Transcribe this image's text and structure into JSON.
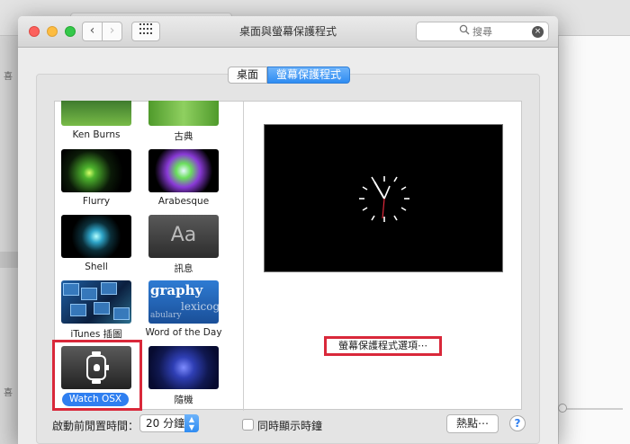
{
  "window": {
    "title": "桌面與螢幕保護程式"
  },
  "toolbar": {
    "back_label": "‹",
    "forward_label": "›",
    "grid_label": "▪▪▪▪"
  },
  "search": {
    "placeholder": "搜尋",
    "clear_label": "×"
  },
  "tabs": [
    {
      "label": "桌面",
      "selected": false
    },
    {
      "label": "螢幕保護程式",
      "selected": true
    }
  ],
  "screensavers": [
    {
      "name": "Ken Burns"
    },
    {
      "name": "古典"
    },
    {
      "name": "Flurry"
    },
    {
      "name": "Arabesque"
    },
    {
      "name": "Shell"
    },
    {
      "name": "訊息",
      "preview_text": "Aa"
    },
    {
      "name": "iTunes 插圖"
    },
    {
      "name": "Word of the Day",
      "preview_words": [
        "graphy",
        "lexicog",
        "abulary"
      ]
    },
    {
      "name": "Watch OSX",
      "selected": true
    },
    {
      "name": "隨機"
    }
  ],
  "options_button": {
    "label": "螢幕保護程式選項⋯"
  },
  "bottom": {
    "start_after_label": "啟動前閒置時間：",
    "delay_value": "20 分鐘",
    "show_clock_label": "同時顯示時鐘",
    "hot_corners_label": "熱點⋯",
    "help_label": "?"
  },
  "background": {
    "sidebar_marks": [
      "喜",
      "喜"
    ]
  },
  "colors": {
    "accent": "#2f7ff0",
    "highlight_box": "#d9283a"
  }
}
